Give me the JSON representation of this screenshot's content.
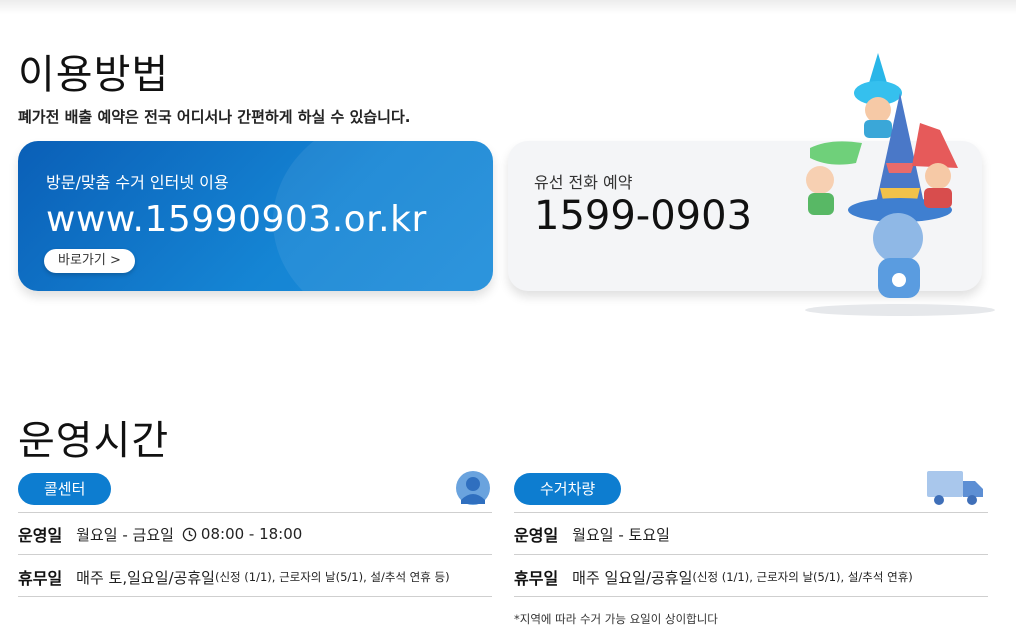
{
  "usage": {
    "title": "이용방법",
    "subtitle": "폐가전 배출 예약은 전국 어디서나 간편하게 하실 수 있습니다.",
    "internet": {
      "label": "방문/맞춤 수거 인터넷 이용",
      "url": "www.15990903.or.kr",
      "button": "바로가기 >"
    },
    "phone": {
      "label": "유선 전화 예약",
      "number": "1599-0903"
    }
  },
  "hours": {
    "title": "운영시간",
    "call_center": {
      "pill": "콜센터",
      "open_key": "운영일",
      "open_value": "월요일 - 금요일",
      "time": "08:00 - 18:00",
      "closed_key": "휴무일",
      "closed_value": "매주 토,일요일/공휴일",
      "closed_note": "(신정 (1/1), 근로자의 날(5/1), 설/추석 연휴 등)"
    },
    "vehicle": {
      "pill": "수거차량",
      "open_key": "운영일",
      "open_value": "월요일 - 토요일",
      "closed_key": "휴무일",
      "closed_value": "매주 일요일/공휴일",
      "closed_note": "(신정 (1/1), 근로자의 날(5/1), 설/추석 연휴)",
      "footnote": "*지역에 따라 수거 가능 요일이 상이합니다"
    }
  },
  "colors": {
    "accent_blue": "#0d7dd0",
    "card_gray": "#f4f5f7"
  },
  "icons": [
    "clock-icon",
    "person-icon",
    "truck-icon"
  ]
}
